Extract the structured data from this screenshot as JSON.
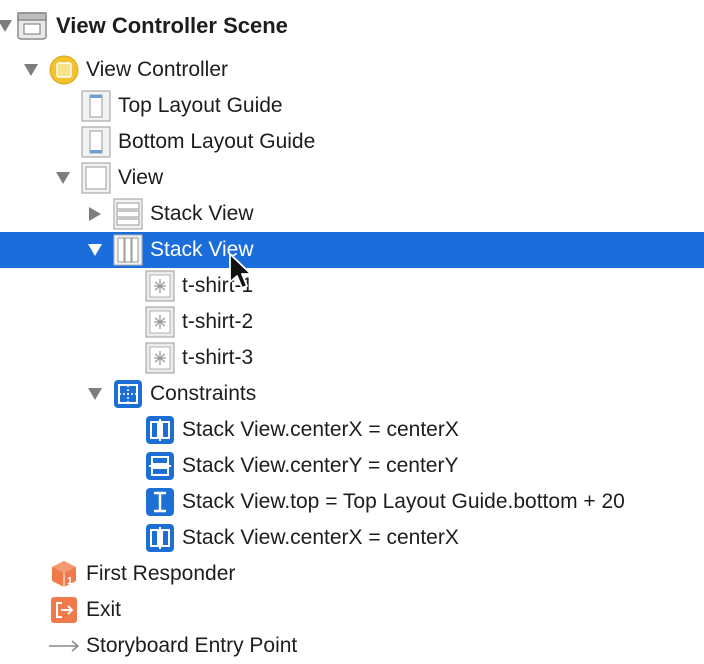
{
  "outline": {
    "scene_title": "View Controller Scene",
    "view_controller": "View Controller",
    "top_layout_guide": "Top Layout Guide",
    "bottom_layout_guide": "Bottom Layout Guide",
    "view": "View",
    "stack_view_1": "Stack View",
    "stack_view_2": "Stack View",
    "images": [
      "t-shirt-1",
      "t-shirt-2",
      "t-shirt-3"
    ],
    "constraints": "Constraints",
    "constraint_items": [
      "Stack View.centerX = centerX",
      "Stack View.centerY = centerY",
      "Stack View.top = Top Layout Guide.bottom + 20",
      "Stack View.centerX = centerX"
    ],
    "first_responder": "First Responder",
    "exit": "Exit",
    "entry_point": "Storyboard Entry Point"
  },
  "colors": {
    "selection": "#1a6ddb",
    "constraint_icon": "#1d6fd6",
    "vc_icon": "#f5c22f",
    "responder_icon": "#f07a4a"
  }
}
